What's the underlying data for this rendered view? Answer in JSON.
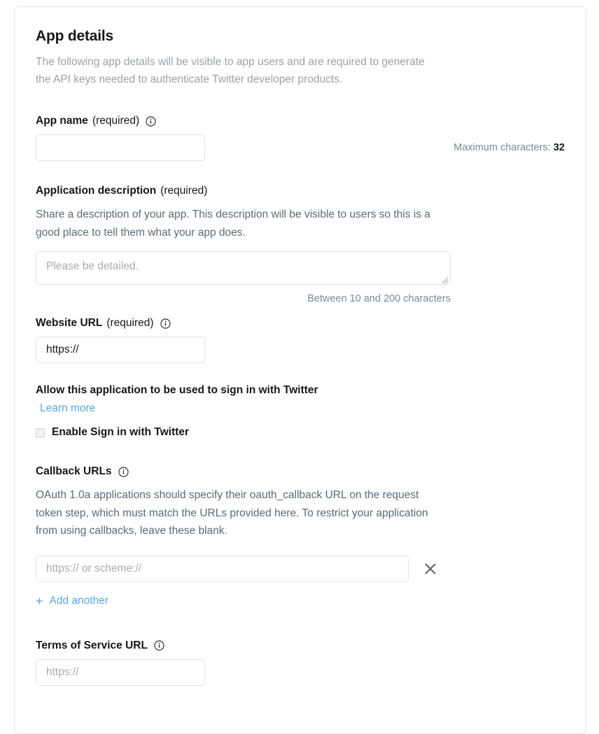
{
  "card": {
    "section_title": "App details",
    "section_help": "The following app details will be visible to app users and are required to generate the API keys needed to authenticate Twitter developer products."
  },
  "app_name": {
    "label": "App name",
    "required_suffix": "(required)",
    "info_icon": "info-icon",
    "value": "",
    "placeholder": "",
    "counter_prefix": "Maximum characters:",
    "counter_value": "32"
  },
  "app_description": {
    "label": "Application description",
    "required_suffix": "(required)",
    "help": "Share a description of your app. This description will be visible to users so this is a good place to tell them what your app does.",
    "placeholder": "Please be detailed.",
    "value": "",
    "counter": "Between 10 and 200 characters"
  },
  "website_url": {
    "label": "Website URL",
    "required_suffix": "(required)",
    "info_icon": "info-icon",
    "value": "https://",
    "placeholder": "https://"
  },
  "sign_in": {
    "heading": "Allow this application to be used to sign in with Twitter",
    "learn_more": "Learn more",
    "checkbox_label": "Enable Sign in with Twitter",
    "checked": false
  },
  "callback_urls": {
    "label": "Callback URLs",
    "info_icon": "info-icon",
    "help": "OAuth 1.0a applications should specify their oauth_callback URL on the request token step, which must match the URLs provided here. To restrict your application from using callbacks, leave these blank.",
    "entries": [
      {
        "value": "",
        "placeholder": "https:// or scheme://"
      }
    ],
    "remove_icon": "close-x-icon",
    "add_another": "Add another",
    "add_icon": "plus-icon"
  },
  "terms_url": {
    "label": "Terms of Service URL",
    "info_icon": "info-icon",
    "value": "",
    "placeholder": "https://"
  },
  "colors": {
    "link": "#5aa6e0",
    "text": "#14171a",
    "muted": "#9aa2a8",
    "body": "#5b6b76",
    "border": "#dfe3e6",
    "card_border": "#e6e8ea"
  }
}
